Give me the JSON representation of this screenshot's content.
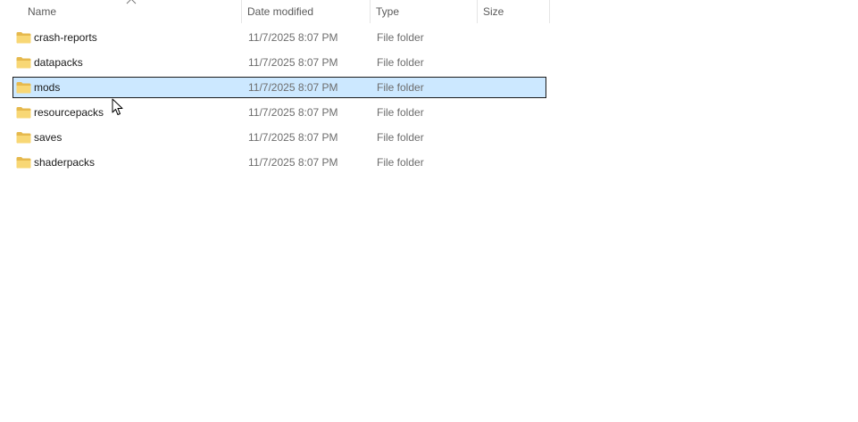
{
  "columns": {
    "name": "Name",
    "date_modified": "Date modified",
    "type": "Type",
    "size": "Size"
  },
  "rows": [
    {
      "name": "crash-reports",
      "date": "11/7/2025 8:07 PM",
      "type": "File folder",
      "size": "",
      "selected": false
    },
    {
      "name": "datapacks",
      "date": "11/7/2025 8:07 PM",
      "type": "File folder",
      "size": "",
      "selected": false
    },
    {
      "name": "mods",
      "date": "11/7/2025 8:07 PM",
      "type": "File folder",
      "size": "",
      "selected": true
    },
    {
      "name": "resourcepacks",
      "date": "11/7/2025 8:07 PM",
      "type": "File folder",
      "size": "",
      "selected": false
    },
    {
      "name": "saves",
      "date": "11/7/2025 8:07 PM",
      "type": "File folder",
      "size": "",
      "selected": false
    },
    {
      "name": "shaderpacks",
      "date": "11/7/2025 8:07 PM",
      "type": "File folder",
      "size": "",
      "selected": false
    }
  ],
  "icons": {
    "folder": "folder-icon",
    "sort": "sort-ascending-icon",
    "cursor": "mouse-cursor-icon"
  },
  "colors": {
    "selection_bg": "#cce8ff",
    "folder_yellow": "#f8d775",
    "folder_dark": "#e6b94d"
  }
}
